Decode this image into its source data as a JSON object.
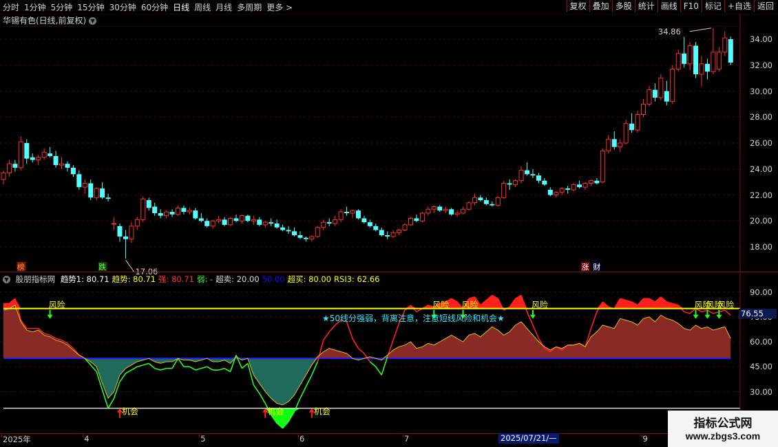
{
  "toolbar": {
    "periods": [
      {
        "label": "分时",
        "active": false
      },
      {
        "label": "1分钟",
        "active": false
      },
      {
        "label": "5分钟",
        "active": false
      },
      {
        "label": "15分钟",
        "active": false
      },
      {
        "label": "30分钟",
        "active": false
      },
      {
        "label": "60分钟",
        "active": false
      },
      {
        "label": "日线",
        "active": true
      },
      {
        "label": "周线",
        "active": false
      },
      {
        "label": "月线",
        "active": false
      },
      {
        "label": "多周期",
        "active": false
      },
      {
        "label": "更多 >",
        "active": false
      }
    ],
    "buttons": [
      "复权",
      "叠加",
      "多股",
      "统计",
      "画线",
      "F10",
      "标记",
      "+自选",
      "返回"
    ]
  },
  "stock": {
    "title": "华锡有色(日线,前复权)"
  },
  "price_chart": {
    "type": "candlestick",
    "y_ticks": [
      "34.00",
      "32.00",
      "30.00",
      "28.00",
      "26.00",
      "24.00",
      "22.00",
      "20.00",
      "18.00"
    ],
    "max_label": "34.86",
    "min_label": "17.06",
    "markers": [
      "榜",
      "跌",
      "涨",
      "财"
    ],
    "ohlc": [
      [
        23.2,
        23.9,
        22.8,
        23.7
      ],
      [
        23.7,
        24.7,
        23.4,
        24.4
      ],
      [
        24.4,
        24.7,
        23.8,
        24.1
      ],
      [
        24.1,
        26.5,
        23.9,
        26.1
      ],
      [
        26.0,
        26.3,
        24.4,
        24.8
      ],
      [
        24.9,
        25.2,
        24.5,
        24.7
      ],
      [
        24.7,
        25.1,
        24.3,
        24.9
      ],
      [
        24.9,
        25.6,
        24.7,
        25.3
      ],
      [
        25.2,
        25.7,
        24.9,
        25.0
      ],
      [
        25.0,
        25.4,
        24.1,
        24.3
      ],
      [
        24.3,
        24.9,
        24.0,
        24.4
      ],
      [
        24.4,
        24.6,
        23.8,
        24.1
      ],
      [
        24.1,
        24.3,
        23.4,
        23.6
      ],
      [
        23.6,
        23.9,
        22.4,
        22.6
      ],
      [
        22.6,
        23.2,
        22.1,
        22.9
      ],
      [
        22.9,
        23.2,
        21.6,
        21.8
      ],
      [
        21.8,
        22.6,
        21.6,
        22.5
      ],
      [
        22.5,
        23.0,
        21.7,
        21.8
      ],
      [
        21.8,
        22.1,
        21.5,
        21.7
      ],
      [
        19.8,
        20.3,
        19.3,
        19.8
      ],
      [
        19.6,
        19.8,
        18.4,
        18.8
      ],
      [
        18.8,
        19.3,
        17.1,
        18.6
      ],
      [
        18.6,
        19.9,
        18.3,
        19.6
      ],
      [
        19.6,
        20.3,
        19.3,
        20.1
      ],
      [
        20.1,
        21.9,
        19.9,
        21.7
      ],
      [
        21.6,
        21.8,
        20.8,
        21.0
      ],
      [
        21.1,
        21.4,
        20.4,
        20.6
      ],
      [
        20.6,
        20.9,
        20.2,
        20.4
      ],
      [
        20.4,
        20.8,
        20.2,
        20.7
      ],
      [
        20.7,
        20.9,
        20.3,
        20.5
      ],
      [
        20.5,
        21.2,
        20.4,
        21.0
      ],
      [
        21.0,
        21.2,
        20.5,
        20.7
      ],
      [
        20.7,
        21.0,
        20.5,
        20.8
      ],
      [
        20.8,
        21.0,
        20.1,
        20.2
      ],
      [
        20.2,
        20.6,
        19.9,
        20.0
      ],
      [
        20.0,
        20.2,
        19.5,
        19.6
      ],
      [
        19.6,
        20.1,
        19.4,
        20.0
      ],
      [
        20.0,
        20.4,
        19.8,
        20.1
      ],
      [
        20.1,
        20.3,
        19.6,
        19.7
      ],
      [
        19.7,
        20.3,
        19.6,
        20.2
      ],
      [
        20.2,
        20.5,
        19.9,
        20.0
      ],
      [
        20.0,
        20.5,
        19.8,
        20.4
      ],
      [
        20.4,
        20.5,
        19.9,
        20.0
      ],
      [
        20.0,
        20.4,
        19.7,
        20.1
      ],
      [
        20.1,
        20.3,
        19.6,
        19.7
      ],
      [
        19.7,
        20.0,
        19.5,
        19.9
      ],
      [
        19.9,
        20.2,
        19.6,
        19.8
      ],
      [
        19.8,
        20.1,
        19.4,
        19.5
      ],
      [
        19.5,
        19.7,
        19.2,
        19.3
      ],
      [
        19.3,
        19.6,
        19.0,
        19.2
      ],
      [
        19.2,
        19.5,
        18.8,
        18.9
      ],
      [
        18.9,
        19.2,
        18.6,
        18.7
      ],
      [
        18.7,
        18.8,
        18.4,
        18.6
      ],
      [
        18.6,
        18.9,
        18.4,
        18.8
      ],
      [
        18.8,
        19.6,
        18.7,
        19.5
      ],
      [
        19.5,
        20.1,
        19.3,
        19.9
      ],
      [
        19.9,
        20.2,
        19.6,
        19.8
      ],
      [
        19.8,
        20.4,
        19.6,
        20.1
      ],
      [
        20.1,
        20.9,
        19.9,
        20.7
      ],
      [
        20.7,
        21.1,
        20.4,
        20.6
      ],
      [
        20.6,
        20.9,
        20.2,
        20.8
      ],
      [
        20.8,
        20.9,
        20.1,
        20.2
      ],
      [
        20.2,
        20.4,
        19.8,
        19.9
      ],
      [
        19.9,
        20.1,
        19.5,
        19.6
      ],
      [
        19.6,
        19.8,
        19.2,
        19.3
      ],
      [
        19.3,
        19.5,
        18.8,
        18.9
      ],
      [
        18.9,
        19.2,
        18.6,
        18.8
      ],
      [
        18.8,
        19.3,
        18.7,
        19.1
      ],
      [
        19.1,
        19.4,
        18.9,
        19.3
      ],
      [
        19.3,
        19.8,
        19.2,
        19.7
      ],
      [
        19.7,
        20.3,
        19.6,
        20.2
      ],
      [
        20.2,
        20.5,
        19.9,
        20.0
      ],
      [
        20.0,
        20.7,
        19.9,
        20.6
      ],
      [
        20.6,
        21.1,
        20.4,
        20.9
      ],
      [
        20.9,
        21.2,
        20.6,
        21.1
      ],
      [
        21.1,
        21.2,
        20.7,
        20.8
      ],
      [
        20.8,
        21.1,
        20.6,
        20.9
      ],
      [
        20.9,
        21.0,
        20.4,
        20.5
      ],
      [
        20.5,
        20.8,
        20.3,
        20.6
      ],
      [
        20.6,
        21.1,
        20.5,
        20.9
      ],
      [
        20.9,
        21.5,
        20.8,
        21.4
      ],
      [
        21.4,
        22.1,
        21.2,
        21.8
      ],
      [
        21.8,
        22.0,
        21.5,
        21.6
      ],
      [
        21.6,
        21.8,
        21.2,
        21.3
      ],
      [
        21.3,
        21.5,
        21.1,
        21.2
      ],
      [
        21.2,
        21.9,
        21.1,
        21.8
      ],
      [
        21.8,
        23.1,
        21.7,
        22.9
      ],
      [
        22.9,
        23.2,
        22.4,
        22.8
      ],
      [
        22.8,
        23.2,
        22.6,
        23.1
      ],
      [
        23.1,
        24.2,
        22.9,
        23.9
      ],
      [
        23.9,
        24.5,
        23.5,
        23.6
      ],
      [
        23.6,
        24.0,
        23.3,
        23.5
      ],
      [
        23.5,
        23.7,
        22.9,
        23.1
      ],
      [
        23.1,
        23.3,
        22.7,
        22.8
      ],
      [
        22.4,
        22.6,
        21.9,
        22.0
      ],
      [
        22.0,
        22.3,
        21.8,
        22.2
      ],
      [
        22.2,
        22.6,
        22.0,
        22.5
      ],
      [
        22.5,
        22.7,
        22.1,
        22.4
      ],
      [
        22.4,
        22.9,
        22.3,
        22.8
      ],
      [
        22.8,
        23.1,
        22.5,
        22.6
      ],
      [
        22.6,
        23.0,
        22.4,
        22.9
      ],
      [
        22.9,
        23.2,
        22.7,
        23.1
      ],
      [
        23.1,
        23.3,
        22.8,
        22.9
      ],
      [
        23.0,
        25.6,
        22.9,
        25.4
      ],
      [
        25.4,
        26.6,
        25.2,
        26.3
      ],
      [
        26.3,
        26.9,
        25.5,
        25.7
      ],
      [
        25.7,
        26.3,
        25.3,
        26.0
      ],
      [
        26.0,
        27.8,
        25.9,
        27.5
      ],
      [
        27.5,
        28.3,
        26.8,
        27.0
      ],
      [
        27.0,
        28.5,
        26.8,
        28.2
      ],
      [
        28.2,
        29.4,
        28.0,
        29.0
      ],
      [
        29.0,
        30.4,
        28.8,
        30.1
      ],
      [
        30.1,
        30.6,
        29.2,
        29.5
      ],
      [
        29.5,
        31.3,
        29.3,
        31.0
      ],
      [
        30.0,
        30.8,
        28.9,
        29.2
      ],
      [
        29.2,
        32.0,
        29.0,
        31.7
      ],
      [
        31.7,
        33.2,
        31.5,
        32.9
      ],
      [
        32.9,
        34.2,
        31.8,
        32.1
      ],
      [
        32.1,
        33.8,
        31.6,
        33.5
      ],
      [
        33.5,
        33.8,
        31.0,
        31.3
      ],
      [
        31.3,
        32.7,
        30.4,
        32.1
      ],
      [
        32.1,
        32.5,
        30.9,
        31.5
      ],
      [
        31.5,
        34.86,
        31.3,
        33.0
      ],
      [
        31.7,
        33.4,
        31.5,
        33.0
      ],
      [
        33.0,
        34.6,
        32.7,
        34.1
      ],
      [
        34.0,
        34.2,
        32.0,
        32.2
      ]
    ]
  },
  "indicator": {
    "name": "股朋指标网",
    "legend": [
      {
        "text": "趋势1: 80.71",
        "color": "#ffffff"
      },
      {
        "text": "趋势: 80.71",
        "color": "#ffff00"
      },
      {
        "text": "强: 80.71",
        "color": "#ff3030"
      },
      {
        "text": "弱: -",
        "color": "#30ff30"
      },
      {
        "text": "超卖: 20.00",
        "color": "#d8d8d8"
      },
      {
        "text": "50.00",
        "color": "#1010ff"
      },
      {
        "text": "超买: 80.00",
        "color": "#ffff00"
      },
      {
        "text": "RSI3: 62.66",
        "color": "#ffff00"
      }
    ],
    "y_ticks": [
      "90.00",
      "75.00",
      "60.00",
      "45.00",
      "30.00"
    ],
    "current_value": "76.55",
    "notice": "★50线分强弱，背离注意，注意短线风险和机会★",
    "signal_labels": {
      "risk": "风险",
      "opportunity": "机会"
    },
    "overbought": 80,
    "oversold": 20,
    "mid": 50,
    "rsi": [
      79,
      80,
      82,
      72,
      67,
      66,
      67,
      64,
      63,
      61,
      60,
      58,
      55,
      52,
      50,
      48,
      45,
      35,
      26,
      30,
      40,
      44,
      46,
      48,
      49,
      50,
      48,
      47,
      48,
      48,
      50,
      49,
      49,
      48,
      49,
      50,
      48,
      48,
      49,
      47,
      51,
      49,
      50,
      40,
      35,
      30,
      26,
      23,
      22,
      24,
      28,
      34,
      40,
      46,
      51,
      54,
      56,
      55,
      54,
      53,
      50,
      49,
      50,
      51,
      50,
      49,
      52,
      55,
      57,
      58,
      60,
      56,
      57,
      59,
      58,
      60,
      62,
      64,
      62,
      60,
      64,
      65,
      63,
      66,
      69,
      67,
      64,
      66,
      70,
      72,
      68,
      64,
      60,
      57,
      55,
      57,
      56,
      58,
      58,
      59,
      57,
      63,
      66,
      70,
      69,
      68,
      74,
      73,
      72,
      70,
      74,
      75,
      72,
      76,
      74,
      73,
      71,
      68,
      67,
      70,
      68,
      69,
      67,
      68,
      69,
      62
    ],
    "strength": [
      83,
      83,
      86,
      73,
      68,
      68,
      68,
      65,
      64,
      62,
      61,
      59,
      56,
      52,
      50,
      46,
      42,
      31,
      20,
      26,
      36,
      41,
      43,
      45,
      46,
      47,
      44,
      43,
      44,
      44,
      50,
      45,
      45,
      43,
      44,
      45,
      43,
      43,
      44,
      42,
      52,
      44,
      47,
      34,
      29,
      23,
      16,
      11,
      8,
      12,
      18,
      26,
      33,
      40,
      48,
      61,
      66,
      70,
      73,
      72,
      62,
      56,
      53,
      48,
      45,
      40,
      51,
      61,
      71,
      79,
      82,
      78,
      80,
      82,
      81,
      83,
      84,
      86,
      84,
      80,
      86,
      87,
      82,
      85,
      88,
      86,
      79,
      81,
      86,
      88,
      78,
      70,
      62,
      56,
      54,
      57,
      55,
      58,
      58,
      59,
      57,
      68,
      78,
      84,
      81,
      80,
      86,
      85,
      84,
      82,
      86,
      86,
      84,
      87,
      84,
      83,
      82,
      78,
      77,
      80,
      78,
      79,
      77,
      78,
      79,
      76
    ]
  },
  "date_axis": {
    "labels": [
      {
        "text": "2025年",
        "col": 0
      },
      {
        "text": "4",
        "col": 14
      },
      {
        "text": "5",
        "col": 34
      },
      {
        "text": "6",
        "col": 51
      },
      {
        "text": "7",
        "col": 69
      },
      {
        "text": "9",
        "col": 110
      }
    ],
    "selected": "2025/07/21/—"
  },
  "watermark": {
    "line1": "指标公式网",
    "line2": "www.zbgs3.com"
  },
  "colors": {
    "up": "#ff3030",
    "down": "#54ffff",
    "grid": "#5a0000",
    "frame": "#8a1010",
    "risk_fill": "#ff2020",
    "strong_fill": "#8a2a26",
    "weak_fill": "#1f6a5a",
    "oversold_fill": "#10ff10"
  }
}
